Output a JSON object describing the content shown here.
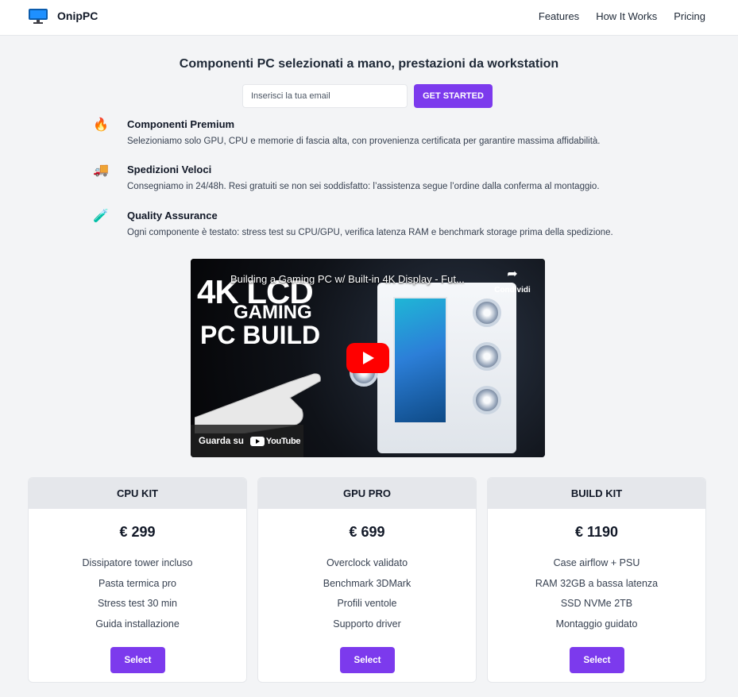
{
  "navbar": {
    "brand_icon": "monitor-icon",
    "brand_name": "OnipPC",
    "links": [
      "Features",
      "How It Works",
      "Pricing"
    ]
  },
  "hero": {
    "title": "Componenti PC selezionati a mano, prestazioni da workstation",
    "email_placeholder": "Inserisci la tua email",
    "cta_label": "GET STARTED"
  },
  "features": [
    {
      "icon": "fire-icon",
      "glyph": "🔥",
      "title": "Componenti Premium",
      "description": "Selezioniamo solo GPU, CPU e memorie di fascia alta, con provenienza certificata per garantire massima affidabilità."
    },
    {
      "icon": "delivery-truck-icon",
      "glyph": "🚚",
      "title": "Spedizioni Veloci",
      "description": "Consegniamo in 24/48h. Resi gratuiti se non sei soddisfatto: l’assistenza segue l’ordine dalla conferma al montaggio."
    },
    {
      "icon": "test-tube-icon",
      "glyph": "🧪",
      "title": "Quality Assurance",
      "description": "Ogni componente è testato: stress test su CPU/GPU, verifica latenza RAM e benchmark storage prima della spedizione."
    }
  ],
  "video": {
    "title": "Building a Gaming PC w/ Built-in 4K Display - Fut...",
    "thumbnail_line1": "4K LCD",
    "thumbnail_line2": "GAMING",
    "thumbnail_line3": "PC BUILD",
    "share_label": "Condividi",
    "watch_on_label": "Guarda su",
    "youtube_label": "YouTube"
  },
  "pricing": [
    {
      "name": "CPU KIT",
      "price": "€ 299",
      "features": [
        "Dissipatore tower incluso",
        "Pasta termica pro",
        "Stress test 30 min",
        "Guida installazione"
      ],
      "button_label": "Select"
    },
    {
      "name": "GPU PRO",
      "price": "€ 699",
      "features": [
        "Overclock validato",
        "Benchmark 3DMark",
        "Profili ventole",
        "Supporto driver"
      ],
      "button_label": "Select"
    },
    {
      "name": "BUILD KIT",
      "price": "€ 1190",
      "features": [
        "Case airflow + PSU",
        "RAM 32GB a bassa latenza",
        "SSD NVMe 2TB",
        "Montaggio guidato"
      ],
      "button_label": "Select"
    }
  ],
  "colors": {
    "accent": "#7c3aed",
    "page_background": "#f3f4f6",
    "card_header": "#e5e7eb",
    "youtube_red": "#ff0000"
  }
}
